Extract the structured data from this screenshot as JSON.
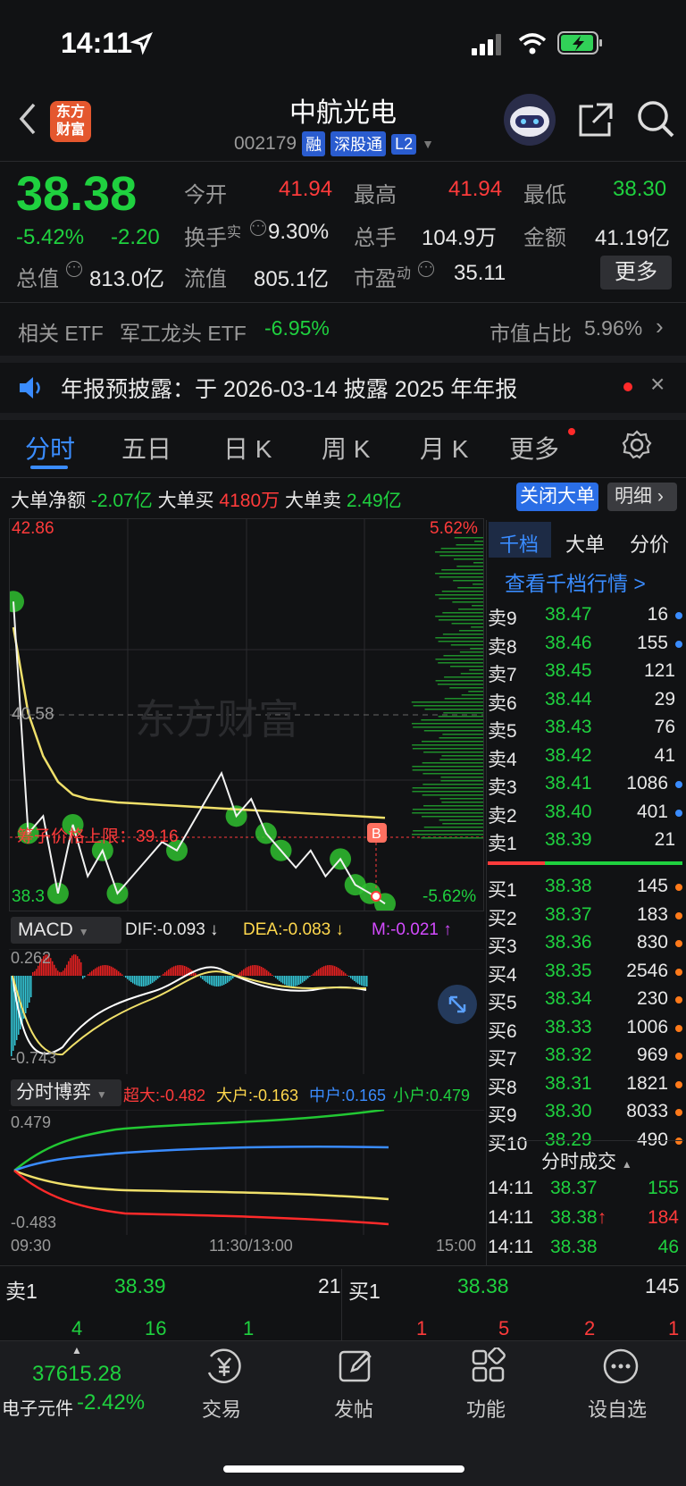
{
  "status_bar": {
    "time": "14:11"
  },
  "header": {
    "logo": "东方财富",
    "title": "中航光电",
    "code": "002179",
    "tags": [
      "融",
      "深股通",
      "L2"
    ]
  },
  "quote": {
    "price": "38.38",
    "change_pct": "-5.42%",
    "change": "-2.20",
    "open_label": "今开",
    "open": "41.94",
    "high_label": "最高",
    "high": "41.94",
    "low_label": "最低",
    "low": "38.30",
    "turnover_label": "换手",
    "turnover_sup": "实",
    "turnover": "9.30%",
    "volume_label": "总手",
    "volume": "104.9万",
    "amount_label": "金额",
    "amount": "41.19亿",
    "mktcap_label": "总值",
    "mktcap": "813.0亿",
    "float_label": "流值",
    "float_cap": "805.1亿",
    "pe_label": "市盈",
    "pe_sup": "动",
    "pe": "35.11",
    "more": "更多"
  },
  "etf": {
    "label": "相关 ETF",
    "name": "军工龙头 ETF",
    "change": "-6.95%",
    "weight_label": "市值占比",
    "weight": "5.96%"
  },
  "notice": {
    "text": "年报预披露：于 2026-03-14 披露 2025 年年报"
  },
  "tabs": [
    "分时",
    "五日",
    "日 K",
    "周 K",
    "月 K",
    "更多"
  ],
  "bigorder": {
    "net_label": "大单净额",
    "net": "-2.07亿",
    "buy_label": "大单买",
    "buy": "4180万",
    "sell_label": "大单卖",
    "sell": "2.49亿",
    "close_btn": "关闭大单",
    "detail_btn": "明细"
  },
  "chart_main": {
    "y_top": "42.86",
    "y_mid": "40.58",
    "y_bot": "38.3",
    "pct_top": "5.62%",
    "pct_bot": "-5.62%",
    "limit_label": "筹子价格上限：39.16",
    "watermark": "东方财富",
    "marker": "B"
  },
  "chart_data": {
    "type": "line",
    "x_labels": [
      "09:30",
      "11:30/13:00",
      "15:00"
    ],
    "ylim": [
      38.3,
      42.86
    ],
    "series": [
      {
        "values": [
          41.9,
          39.2,
          39.4,
          38.5,
          39.3,
          38.7,
          39.0,
          38.5,
          38.7,
          38.9,
          39.1,
          39.0,
          39.3,
          39.6,
          39.9,
          39.4,
          39.6,
          39.2,
          39.0,
          38.8,
          39.0,
          38.7,
          38.9,
          38.6,
          38.5,
          38.38
        ]
      },
      {
        "values": [
          41.6,
          40.6,
          40.1,
          39.8,
          39.65,
          39.6,
          39.58,
          39.56,
          39.55,
          39.54,
          39.53,
          39.52,
          39.51,
          39.5,
          39.49,
          39.48,
          39.47,
          39.46,
          39.45,
          39.44,
          39.43,
          39.42,
          39.41,
          39.4,
          39.39,
          39.38
        ]
      }
    ]
  },
  "macd": {
    "label": "MACD",
    "dif": "DIF:-0.093 ↓",
    "dea": "DEA:-0.083 ↓",
    "m": "M:-0.021 ↑",
    "y_top": "0.262",
    "y_bot": "-0.743"
  },
  "game": {
    "label": "分时博弈",
    "super": "超大:-0.482",
    "big": "大户:-0.163",
    "mid": "中户:0.165",
    "small": "小户:0.479",
    "y_top": "0.479",
    "y_bot": "-0.483",
    "x_start": "09:30",
    "x_mid": "11:30/13:00",
    "x_end": "15:00"
  },
  "side": {
    "tabs": [
      "千档",
      "大单",
      "分价"
    ],
    "link": "查看千档行情 >",
    "asks": [
      {
        "label": "卖9",
        "price": "38.47",
        "vol": "16",
        "dot": "blue"
      },
      {
        "label": "卖8",
        "price": "38.46",
        "vol": "155",
        "dot": "blue"
      },
      {
        "label": "卖7",
        "price": "38.45",
        "vol": "121",
        "dot": ""
      },
      {
        "label": "卖6",
        "price": "38.44",
        "vol": "29",
        "dot": ""
      },
      {
        "label": "卖5",
        "price": "38.43",
        "vol": "76",
        "dot": ""
      },
      {
        "label": "卖4",
        "price": "38.42",
        "vol": "41",
        "dot": ""
      },
      {
        "label": "卖3",
        "price": "38.41",
        "vol": "1086",
        "dot": "blue"
      },
      {
        "label": "卖2",
        "price": "38.40",
        "vol": "401",
        "dot": "blue"
      },
      {
        "label": "卖1",
        "price": "38.39",
        "vol": "21",
        "dot": ""
      }
    ],
    "bids": [
      {
        "label": "买1",
        "price": "38.38",
        "vol": "145",
        "dot": "orange"
      },
      {
        "label": "买2",
        "price": "38.37",
        "vol": "183",
        "dot": "orange"
      },
      {
        "label": "买3",
        "price": "38.36",
        "vol": "830",
        "dot": "orange"
      },
      {
        "label": "买4",
        "price": "38.35",
        "vol": "2546",
        "dot": "orange"
      },
      {
        "label": "买5",
        "price": "38.34",
        "vol": "230",
        "dot": "orange"
      },
      {
        "label": "买6",
        "price": "38.33",
        "vol": "1006",
        "dot": "orange"
      },
      {
        "label": "买7",
        "price": "38.32",
        "vol": "969",
        "dot": "orange"
      },
      {
        "label": "买8",
        "price": "38.31",
        "vol": "1821",
        "dot": "orange"
      },
      {
        "label": "买9",
        "price": "38.30",
        "vol": "8033",
        "dot": "orange"
      },
      {
        "label": "买10",
        "price": "38.29",
        "vol": "490",
        "dot": "orange"
      }
    ],
    "trades_title": "分时成交",
    "trades": [
      {
        "time": "14:11",
        "price": "38.37",
        "vol": "155",
        "dir": ""
      },
      {
        "time": "14:11",
        "price": "38.38↑",
        "vol": "184",
        "dir": "up"
      },
      {
        "time": "14:11",
        "price": "38.38",
        "vol": "46",
        "dir": ""
      }
    ]
  },
  "level1": {
    "ask_label": "卖1",
    "ask_price": "38.39",
    "ask_vol": "21",
    "bid_label": "买1",
    "bid_price": "38.38",
    "bid_vol": "145",
    "ask_counts": [
      "4",
      "16",
      "1"
    ],
    "bid_counts": [
      "1",
      "5",
      "2",
      "1"
    ]
  },
  "bottom": {
    "index_value": "37615.28",
    "index_name": "电子元件",
    "index_change": "-2.42%",
    "nav": [
      "交易",
      "发帖",
      "功能",
      "设自选"
    ]
  }
}
